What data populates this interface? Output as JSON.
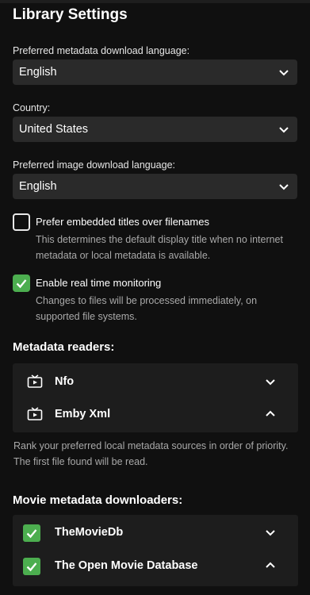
{
  "title": "Library Settings",
  "fields": {
    "metadata_language": {
      "label": "Preferred metadata download language:",
      "value": "English"
    },
    "country": {
      "label": "Country:",
      "value": "United States"
    },
    "image_language": {
      "label": "Preferred image download language:",
      "value": "English"
    }
  },
  "options": {
    "embedded_titles": {
      "label": "Prefer embedded titles over filenames",
      "checked": false,
      "description": "This determines the default display title when no internet metadata or local metadata is available."
    },
    "realtime_monitoring": {
      "label": "Enable real time monitoring",
      "checked": true,
      "description": "Changes to files will be processed immediately, on supported file systems."
    }
  },
  "metadata_readers": {
    "heading": "Metadata readers:",
    "items": [
      {
        "name": "Nfo",
        "icon": "tv-icon",
        "arrow": "chevron-down"
      },
      {
        "name": "Emby Xml",
        "icon": "tv-icon",
        "arrow": "chevron-up"
      }
    ],
    "description": "Rank your preferred local metadata sources in order of priority. The first file found will be read."
  },
  "movie_downloaders": {
    "heading": "Movie metadata downloaders:",
    "items": [
      {
        "name": "TheMovieDb",
        "checked": true,
        "arrow": "chevron-down"
      },
      {
        "name": "The Open Movie Database",
        "checked": true,
        "arrow": "chevron-up"
      }
    ]
  },
  "colors": {
    "background": "#101010",
    "input": "#2a2a2a",
    "panel": "#1d1d1d",
    "accent_green": "#4cae4f",
    "muted_text": "#a9a9a9"
  }
}
